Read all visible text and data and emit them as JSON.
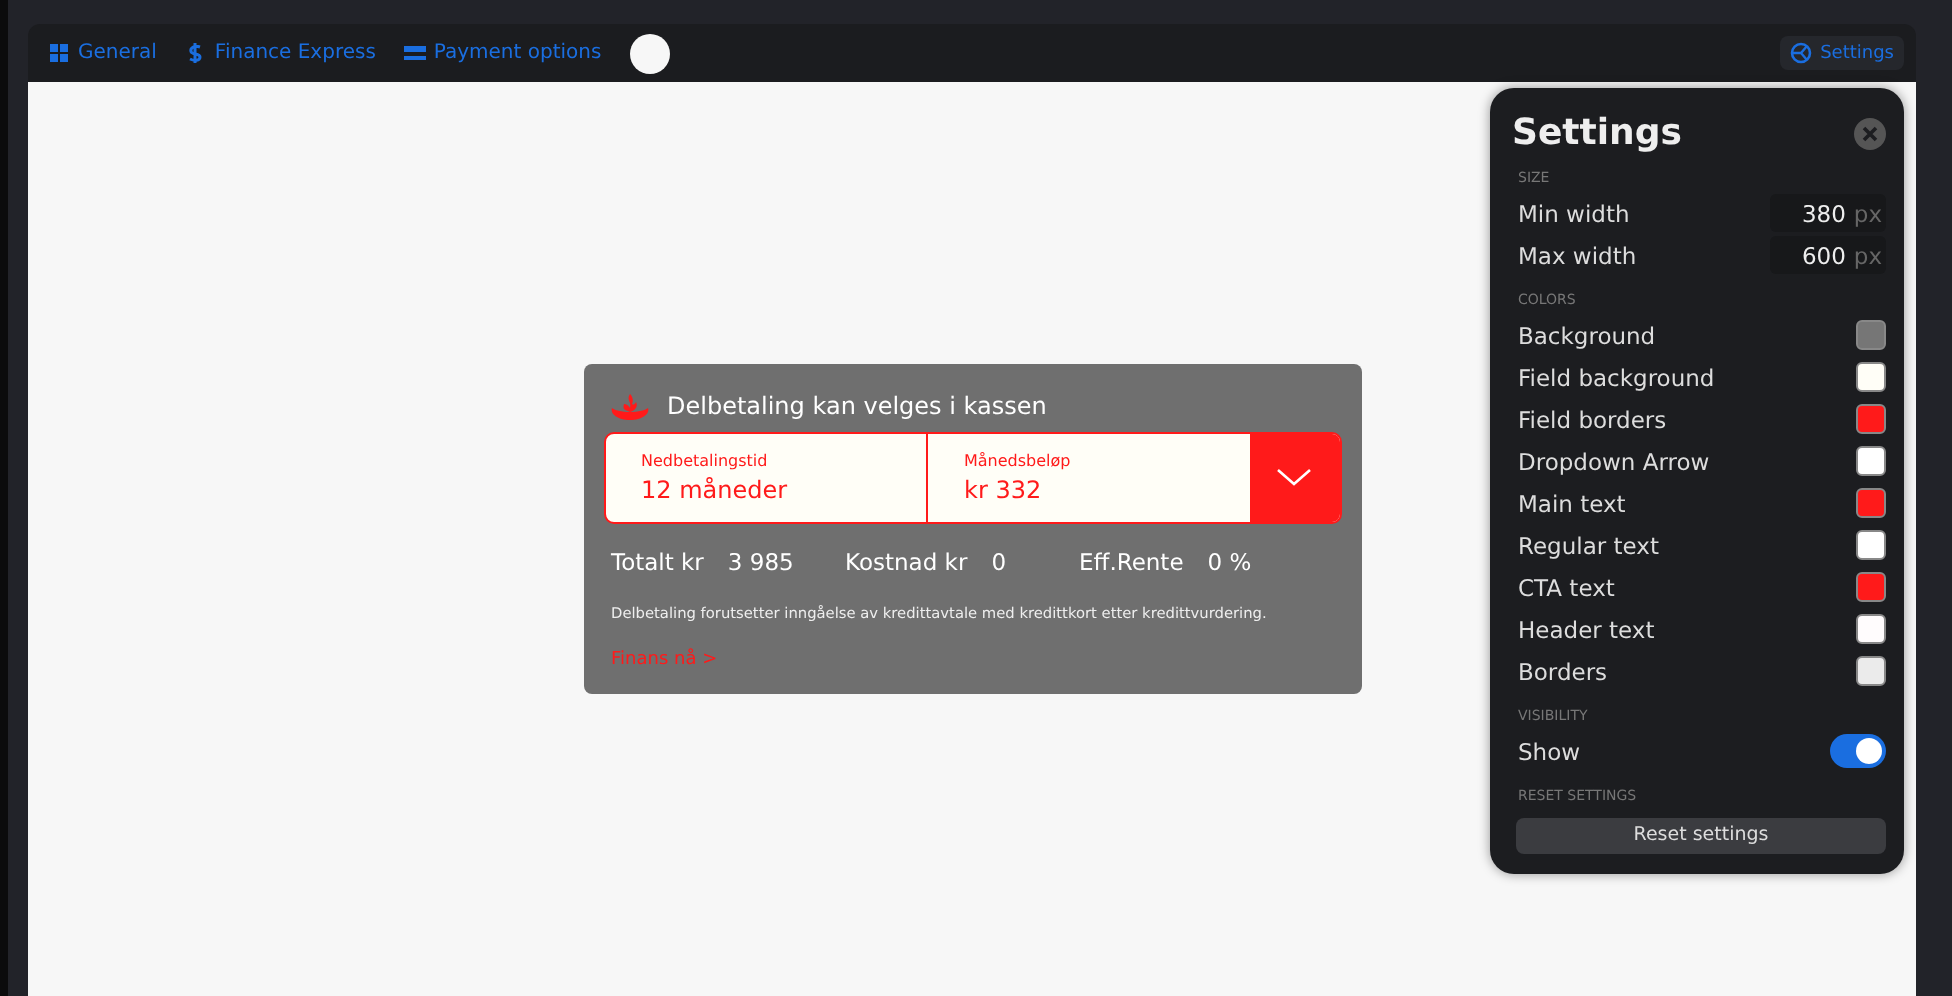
{
  "toolbar": {
    "tabs": [
      {
        "label": "General"
      },
      {
        "label": "Finance Express"
      },
      {
        "label": "Payment options"
      }
    ],
    "settings_button": "Settings"
  },
  "widget": {
    "header": "Delbetaling kan velges i kassen",
    "fields": [
      {
        "label": "Nedbetalingstid",
        "value": "12 måneder"
      },
      {
        "label": "Månedsbeløp",
        "value": "kr 332"
      }
    ],
    "summary": [
      {
        "label": "Totalt kr",
        "value": "3 985"
      },
      {
        "label": "Kostnad kr",
        "value": "0"
      },
      {
        "label": "Eff.Rente",
        "value": "0 %"
      }
    ],
    "disclaimer": "Delbetaling forutsetter inngåelse av kredittavtale med kredittkort etter kredittvurdering.",
    "cta": "Finans nå >"
  },
  "settings": {
    "title": "Settings",
    "size_heading": "SIZE",
    "size": [
      {
        "label": "Min width",
        "value": "380",
        "unit": "px"
      },
      {
        "label": "Max width",
        "value": "600",
        "unit": "px"
      }
    ],
    "colors_heading": "COLORS",
    "colors": [
      {
        "label": "Background",
        "color": "#767676"
      },
      {
        "label": "Field background",
        "color": "#fffef7"
      },
      {
        "label": "Field borders",
        "color": "#ff1a1a"
      },
      {
        "label": "Dropdown Arrow",
        "color": "#ffffff"
      },
      {
        "label": "Main text",
        "color": "#ff1a1a"
      },
      {
        "label": "Regular text",
        "color": "#ffffff"
      },
      {
        "label": "CTA text",
        "color": "#ff1a1a"
      },
      {
        "label": "Header text",
        "color": "#fffcfd"
      },
      {
        "label": "Borders",
        "color": "#ebebeb"
      }
    ],
    "visibility_heading": "VISIBILITY",
    "visibility": {
      "label": "Show",
      "on": true
    },
    "reset_heading": "RESET SETTINGS",
    "reset_button": "Reset settings"
  }
}
